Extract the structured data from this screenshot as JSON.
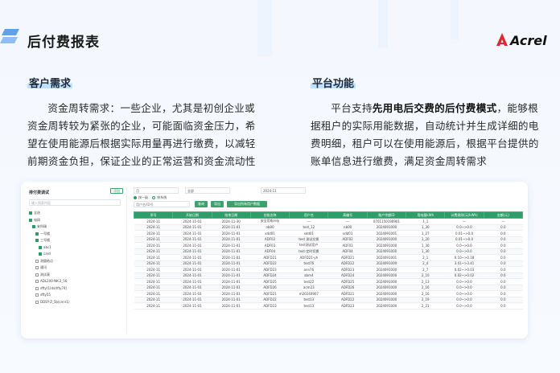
{
  "page": {
    "title": "后付费报表",
    "logo_text": "Acrel",
    "colors": {
      "accent": "#2f9e6b",
      "title_highlight": "#bfe0ff",
      "logo_red": "#d9282f"
    }
  },
  "left_section": {
    "heading": "客户需求",
    "paragraph": "资金周转需求：一些企业，尤其是初创企业或资金周转较为紧张的企业，可能面临资金压力，希望在使用能源后根据实际用量再进行缴费，以减轻前期资金负担，保证企业的正常运营和资金流动性"
  },
  "right_section": {
    "heading": "平台功能",
    "paragraph_before": "平台支持",
    "paragraph_bold": "先用电后交费的后付费模式",
    "paragraph_after": "，能够根据租户的实际用能数据，自动统计并生成详细的电费明细，租户可以在使用能源后，根据平台提供的账单信息进行缴费，满足资金周转需求"
  },
  "screenshot": {
    "panel_title": "排付费调试",
    "panel_button": "添加",
    "search_placeholder": "输入搜索内容",
    "tree": [
      {
        "label": "全选",
        "checked": true
      },
      {
        "label": "电网",
        "checked": true
      },
      {
        "label": "安科瑞",
        "checked": true
      },
      {
        "label": "一号楼",
        "checked": true
      },
      {
        "label": "三号楼",
        "checked": true
      },
      {
        "label": "abc1",
        "checked": true
      },
      {
        "label": "card",
        "checked": true
      },
      {
        "label": "测量结点",
        "checked": false
      },
      {
        "label": "通讯",
        "checked": false
      },
      {
        "label": "测试表",
        "checked": false
      },
      {
        "label": "ADL200-NK-2_56",
        "checked": false
      },
      {
        "label": "dfty(1)ds(tfty74)",
        "checked": false
      },
      {
        "label": "dfty55",
        "checked": false
      },
      {
        "label": "DDSY-Z_5b(cnnr1)",
        "checked": false
      }
    ],
    "filter_select_1": "月",
    "filter_select_2": "全部",
    "filter_date": "2024-11",
    "radio_1": "按一级",
    "radio_2": "按系统",
    "toolbar_input": "用户名/ID号",
    "btn_query": "查询",
    "btn_export": "导出",
    "btn_export_all": "导出所有用户数据",
    "columns": [
      "序号",
      "开始日期",
      "结束日期",
      "台账名称",
      "用户名",
      "表编号",
      "账户余额ID",
      "用电量kWh",
      "计费规则(元/kWh)",
      "金额(元)"
    ],
    "rows": [
      [
        "2024-11",
        "2024-11-01",
        "2024-11-30",
        "安全用电rely",
        "—",
        "—",
        "0701150190901",
        "1_1",
        "—",
        "—"
      ],
      [
        "2024-11",
        "2024-11-01",
        "2024-11-01",
        "nb00",
        "test_12",
        "nb00",
        "2024091000",
        "1_30",
        "0.0~>0.0",
        "0.0"
      ],
      [
        "2024-11",
        "2024-11-01",
        "2024-11-01",
        "xdd01",
        "xdd01",
        "xdd01",
        "2024091001",
        "1_27",
        "0.01~>0.0",
        "0.0"
      ],
      [
        "2024-11",
        "2024-11-01",
        "2024-11-01",
        "ADF02",
        "test 测试交换",
        "ADF02",
        "2024091000",
        "1_20",
        "0.01~>0.0",
        "0.0"
      ],
      [
        "2024-11",
        "2024-11-01",
        "2024-11-01",
        "ADF03",
        "test测试用户",
        "ADF03",
        "2024091000",
        "1_30",
        "0.0~>0.0",
        "0.0"
      ],
      [
        "2024-11",
        "2024-11-01",
        "2024-11-01",
        "ADF04",
        "test-定时切换",
        "ADF04",
        "2024091000",
        "1_30",
        "0.0~>0.0",
        "0.0"
      ],
      [
        "2024-11",
        "2024-11-01",
        "2024-11-01",
        "ADFD21",
        "ADFD21-yh",
        "ADFD21",
        "2024091001",
        "2_1",
        "0.10~>0.18",
        "0.0"
      ],
      [
        "2024-11",
        "2024-11-01",
        "2024-11-01",
        "ADFD22",
        "test76",
        "ADFD22",
        "2024091000",
        "2_4",
        "3.41~>3.41",
        "0.0"
      ],
      [
        "2024-11",
        "2024-11-01",
        "2024-11-01",
        "ADFD23",
        "ann76",
        "ADFD23",
        "2024091000",
        "2_7",
        "0.02~>0.03",
        "0.0"
      ],
      [
        "2024-11",
        "2024-11-01",
        "2024-11-01",
        "ADFD24",
        "abm4",
        "ADFD24",
        "2024091000",
        "2_10",
        "0.02~>0.02",
        "0.0"
      ],
      [
        "2024-11",
        "2024-11-01",
        "2024-11-01",
        "ADFD25",
        "test22",
        "ADFD25",
        "2024091000",
        "2_13",
        "0.0~>0.0",
        "0.0"
      ],
      [
        "2024-11",
        "2024-11-01",
        "2024-11-01",
        "ADFD26",
        "acm23",
        "ADFD26",
        "2024091000",
        "2_16",
        "0.0~>0.0",
        "0.0"
      ],
      [
        "2024-11",
        "2024-11-01",
        "2024-11-01",
        "ADFD21",
        "m20240907",
        "ADFD21",
        "2024091000",
        "2_16",
        "0.0~>0.0",
        "0.0"
      ],
      [
        "2024-11",
        "2024-11-01",
        "2024-11-01",
        "ADFD22",
        "test13",
        "ADFD22",
        "2024091000",
        "2_19",
        "0.0~>0.0",
        "0.0"
      ],
      [
        "2024-11",
        "2024-11-01",
        "2024-11-01",
        "ADFD23",
        "test13",
        "ADFD23",
        "2024091000",
        "2_21",
        "0.0~>0.0",
        "0.0"
      ]
    ]
  }
}
